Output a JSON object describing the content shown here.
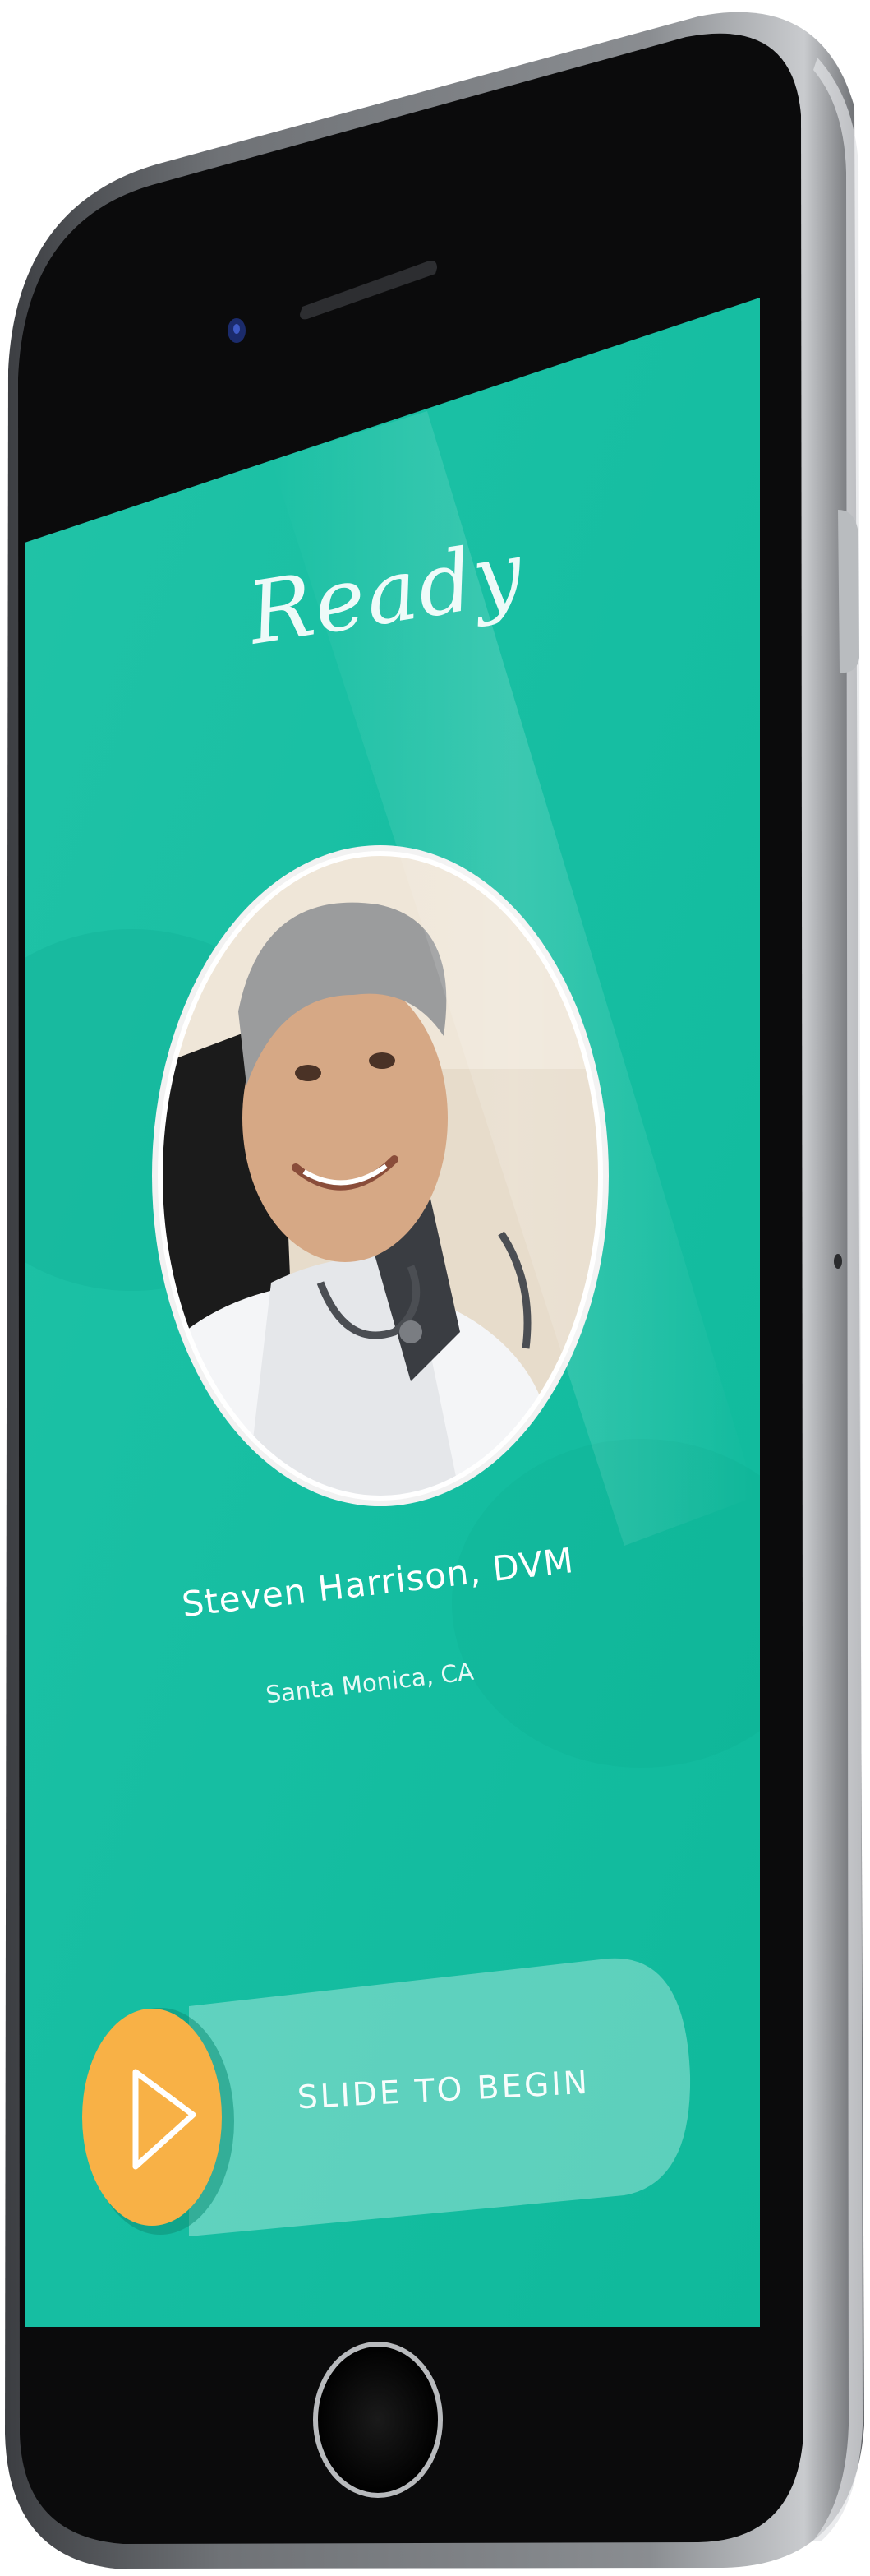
{
  "screen": {
    "title": "Ready",
    "background_color": "#14bfa2",
    "accent_color": "#f8b146"
  },
  "doctor": {
    "name": "Steven Harrison, DVM",
    "location": "Santa Monica, CA",
    "photo_icon": "doctor-portrait"
  },
  "slider": {
    "label": "SLIDE TO BEGIN",
    "icon": "play-icon"
  },
  "device": {
    "color": "#6b6e72",
    "home_button_icon": "home-button"
  }
}
